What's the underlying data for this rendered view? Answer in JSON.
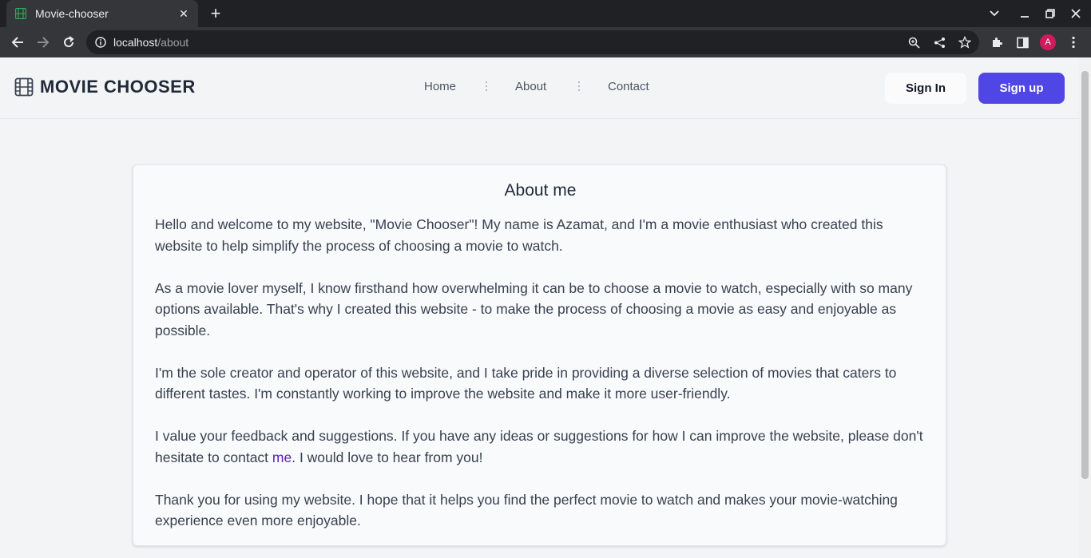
{
  "browser": {
    "tab_title": "Movie-chooser",
    "url_host": "localhost",
    "url_path": "/about",
    "profile_initial": "A"
  },
  "navbar": {
    "brand": "MOVIE CHOOSER",
    "links": [
      "Home",
      "About",
      "Contact"
    ],
    "signin": "Sign In",
    "signup": "Sign up"
  },
  "about": {
    "title": "About me",
    "p1": "Hello and welcome to my website, \"Movie Chooser\"! My name is Azamat, and I'm a movie enthusiast who created this website to help simplify the process of choosing a movie to watch.",
    "p2": "As a movie lover myself, I know firsthand how overwhelming it can be to choose a movie to watch, especially with so many options available. That's why I created this website - to make the process of choosing a movie as easy and enjoyable as possible.",
    "p3": "I'm the sole creator and operator of this website, and I take pride in providing a diverse selection of movies that caters to different tastes. I'm constantly working to improve the website and make it more user-friendly.",
    "p4_before": "I value your feedback and suggestions. If you have any ideas or suggestions for how I can improve the website, please don't hesitate to contact ",
    "p4_link": "me",
    "p4_after": ". I would love to hear from you!",
    "p5": "Thank you for using my website. I hope that it helps you find the perfect movie to watch and makes your movie-watching experience even more enjoyable."
  },
  "colors": {
    "accent": "#4f46e5",
    "link": "#5b21b6"
  }
}
